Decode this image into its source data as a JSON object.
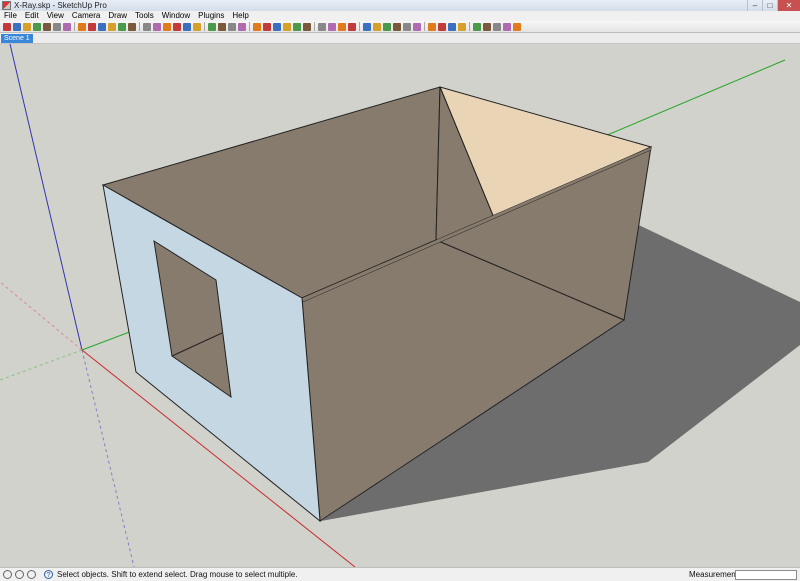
{
  "window": {
    "title": "X-Ray.skp - SketchUp Pro",
    "controls": {
      "minimize": "–",
      "maximize": "□",
      "close": "✕"
    }
  },
  "menu": {
    "items": [
      "File",
      "Edit",
      "View",
      "Camera",
      "Draw",
      "Tools",
      "Window",
      "Plugins",
      "Help"
    ]
  },
  "toolbar": {
    "icons": [
      "select-tool-icon",
      "paint-bucket-icon",
      "eraser-icon",
      "pencil-icon",
      "line-icon",
      "arc-icon",
      "freehand-icon",
      "rectangle-icon",
      "circle-icon",
      "polygon-icon",
      "move-icon",
      "push-pull-icon",
      "rotate-icon",
      "follow-me-icon",
      "scale-icon",
      "offset-icon",
      "tape-measure-icon",
      "dimension-icon",
      "protractor-icon",
      "text-icon",
      "axes-icon",
      "3d-text-icon",
      "orbit-icon",
      "pan-icon",
      "zoom-icon",
      "zoom-window-icon",
      "zoom-extents-icon",
      "previous-view-icon",
      "iso-view-icon",
      "top-view-icon",
      "front-view-icon",
      "right-view-icon",
      "xray-icon",
      "wireframe-icon",
      "hidden-line-icon",
      "shaded-icon",
      "shaded-textures-icon",
      "monochrome-icon",
      "section-plane-icon",
      "display-sections-icon",
      "get-models-icon",
      "share-model-icon",
      "shadows-icon",
      "fog-icon",
      "walk-icon",
      "position-camera-icon",
      "look-around-icon",
      "sandbox-icon"
    ]
  },
  "scenes": {
    "tabs": [
      "Scene 1"
    ]
  },
  "status": {
    "icons": [
      "geo-location-icon",
      "credits-icon",
      "user-icon",
      "help-icon"
    ],
    "help_glyph": "?",
    "message": "Select objects. Shift to extend select. Drag mouse to select multiple.",
    "measurements_label": "Measurements",
    "measurements_value": ""
  },
  "colors": {
    "sky": "#d2d2cc",
    "ground": "#d2d2cc",
    "wall_dark": "#877b6d",
    "wall_light_front": "#c6d7e4",
    "wall_sunlit": "#e9d5b6",
    "shadow": "#6d6d6d",
    "axis_red": "#c8282a",
    "axis_green": "#2aa62a",
    "axis_blue": "#3434b0",
    "scene_tab": "#3a86d8"
  }
}
